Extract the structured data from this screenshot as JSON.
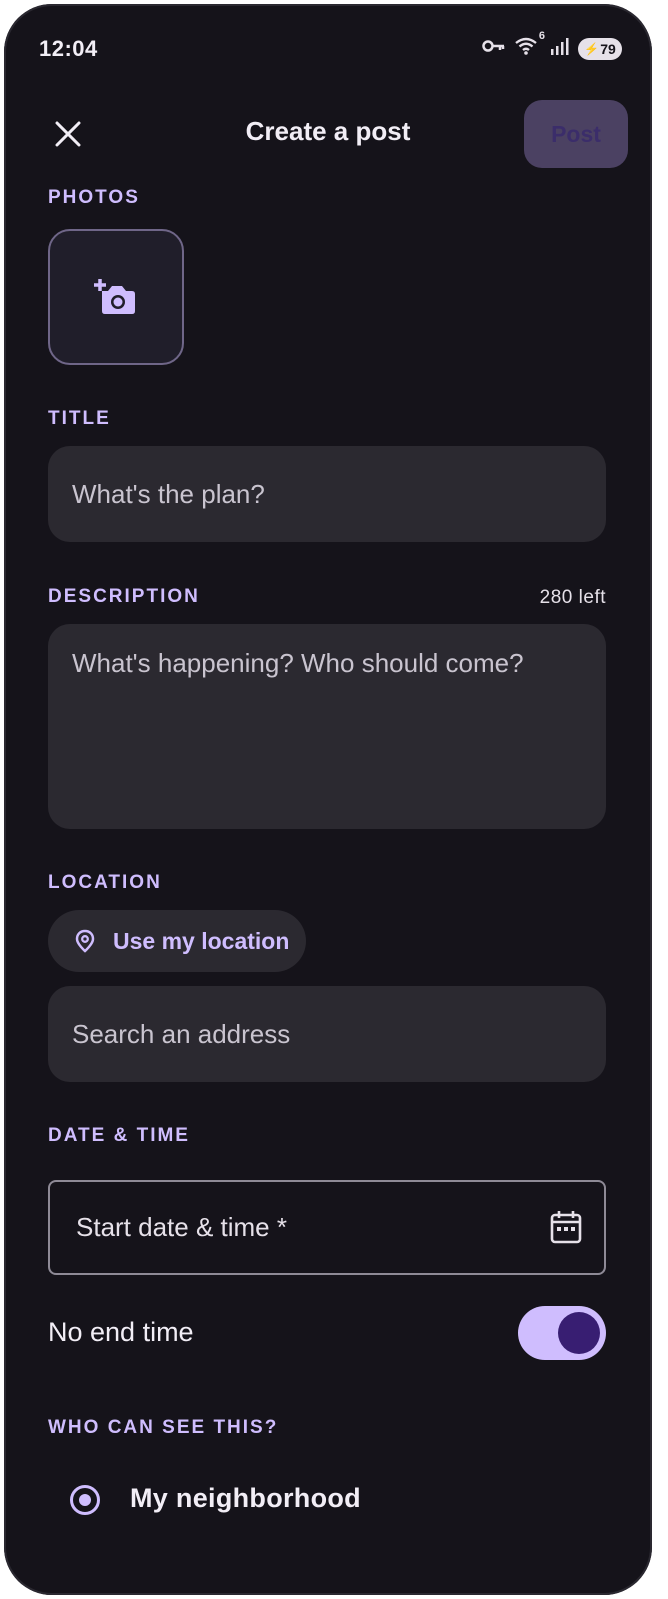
{
  "status_bar": {
    "time": "12:04",
    "signal_badge": "6",
    "battery": "79"
  },
  "header": {
    "title": "Create a post",
    "post_label": "Post"
  },
  "photos": {
    "label": "PHOTOS"
  },
  "title_section": {
    "label": "TITLE",
    "placeholder": "What's the plan?"
  },
  "description": {
    "label": "DESCRIPTION",
    "counter": "280 left",
    "placeholder": "What's happening? Who should come?"
  },
  "location": {
    "label": "LOCATION",
    "use_location": "Use my location",
    "search_placeholder": "Search an address"
  },
  "datetime": {
    "label": "DATE & TIME",
    "start_label": "Start date & time *",
    "no_end_label": "No end time",
    "no_end_on": true
  },
  "visibility": {
    "label": "WHO CAN SEE THIS?",
    "option": "My neighborhood",
    "selected": true
  },
  "colors": {
    "background": "#15131a",
    "accent": "#cfbdfe",
    "field": "#2b2930",
    "post_button": "#4b4162"
  },
  "icons": [
    "close-icon",
    "add-photo-icon",
    "location-pin-icon",
    "calendar-icon",
    "wifi-icon",
    "key-icon",
    "signal-icon"
  ]
}
